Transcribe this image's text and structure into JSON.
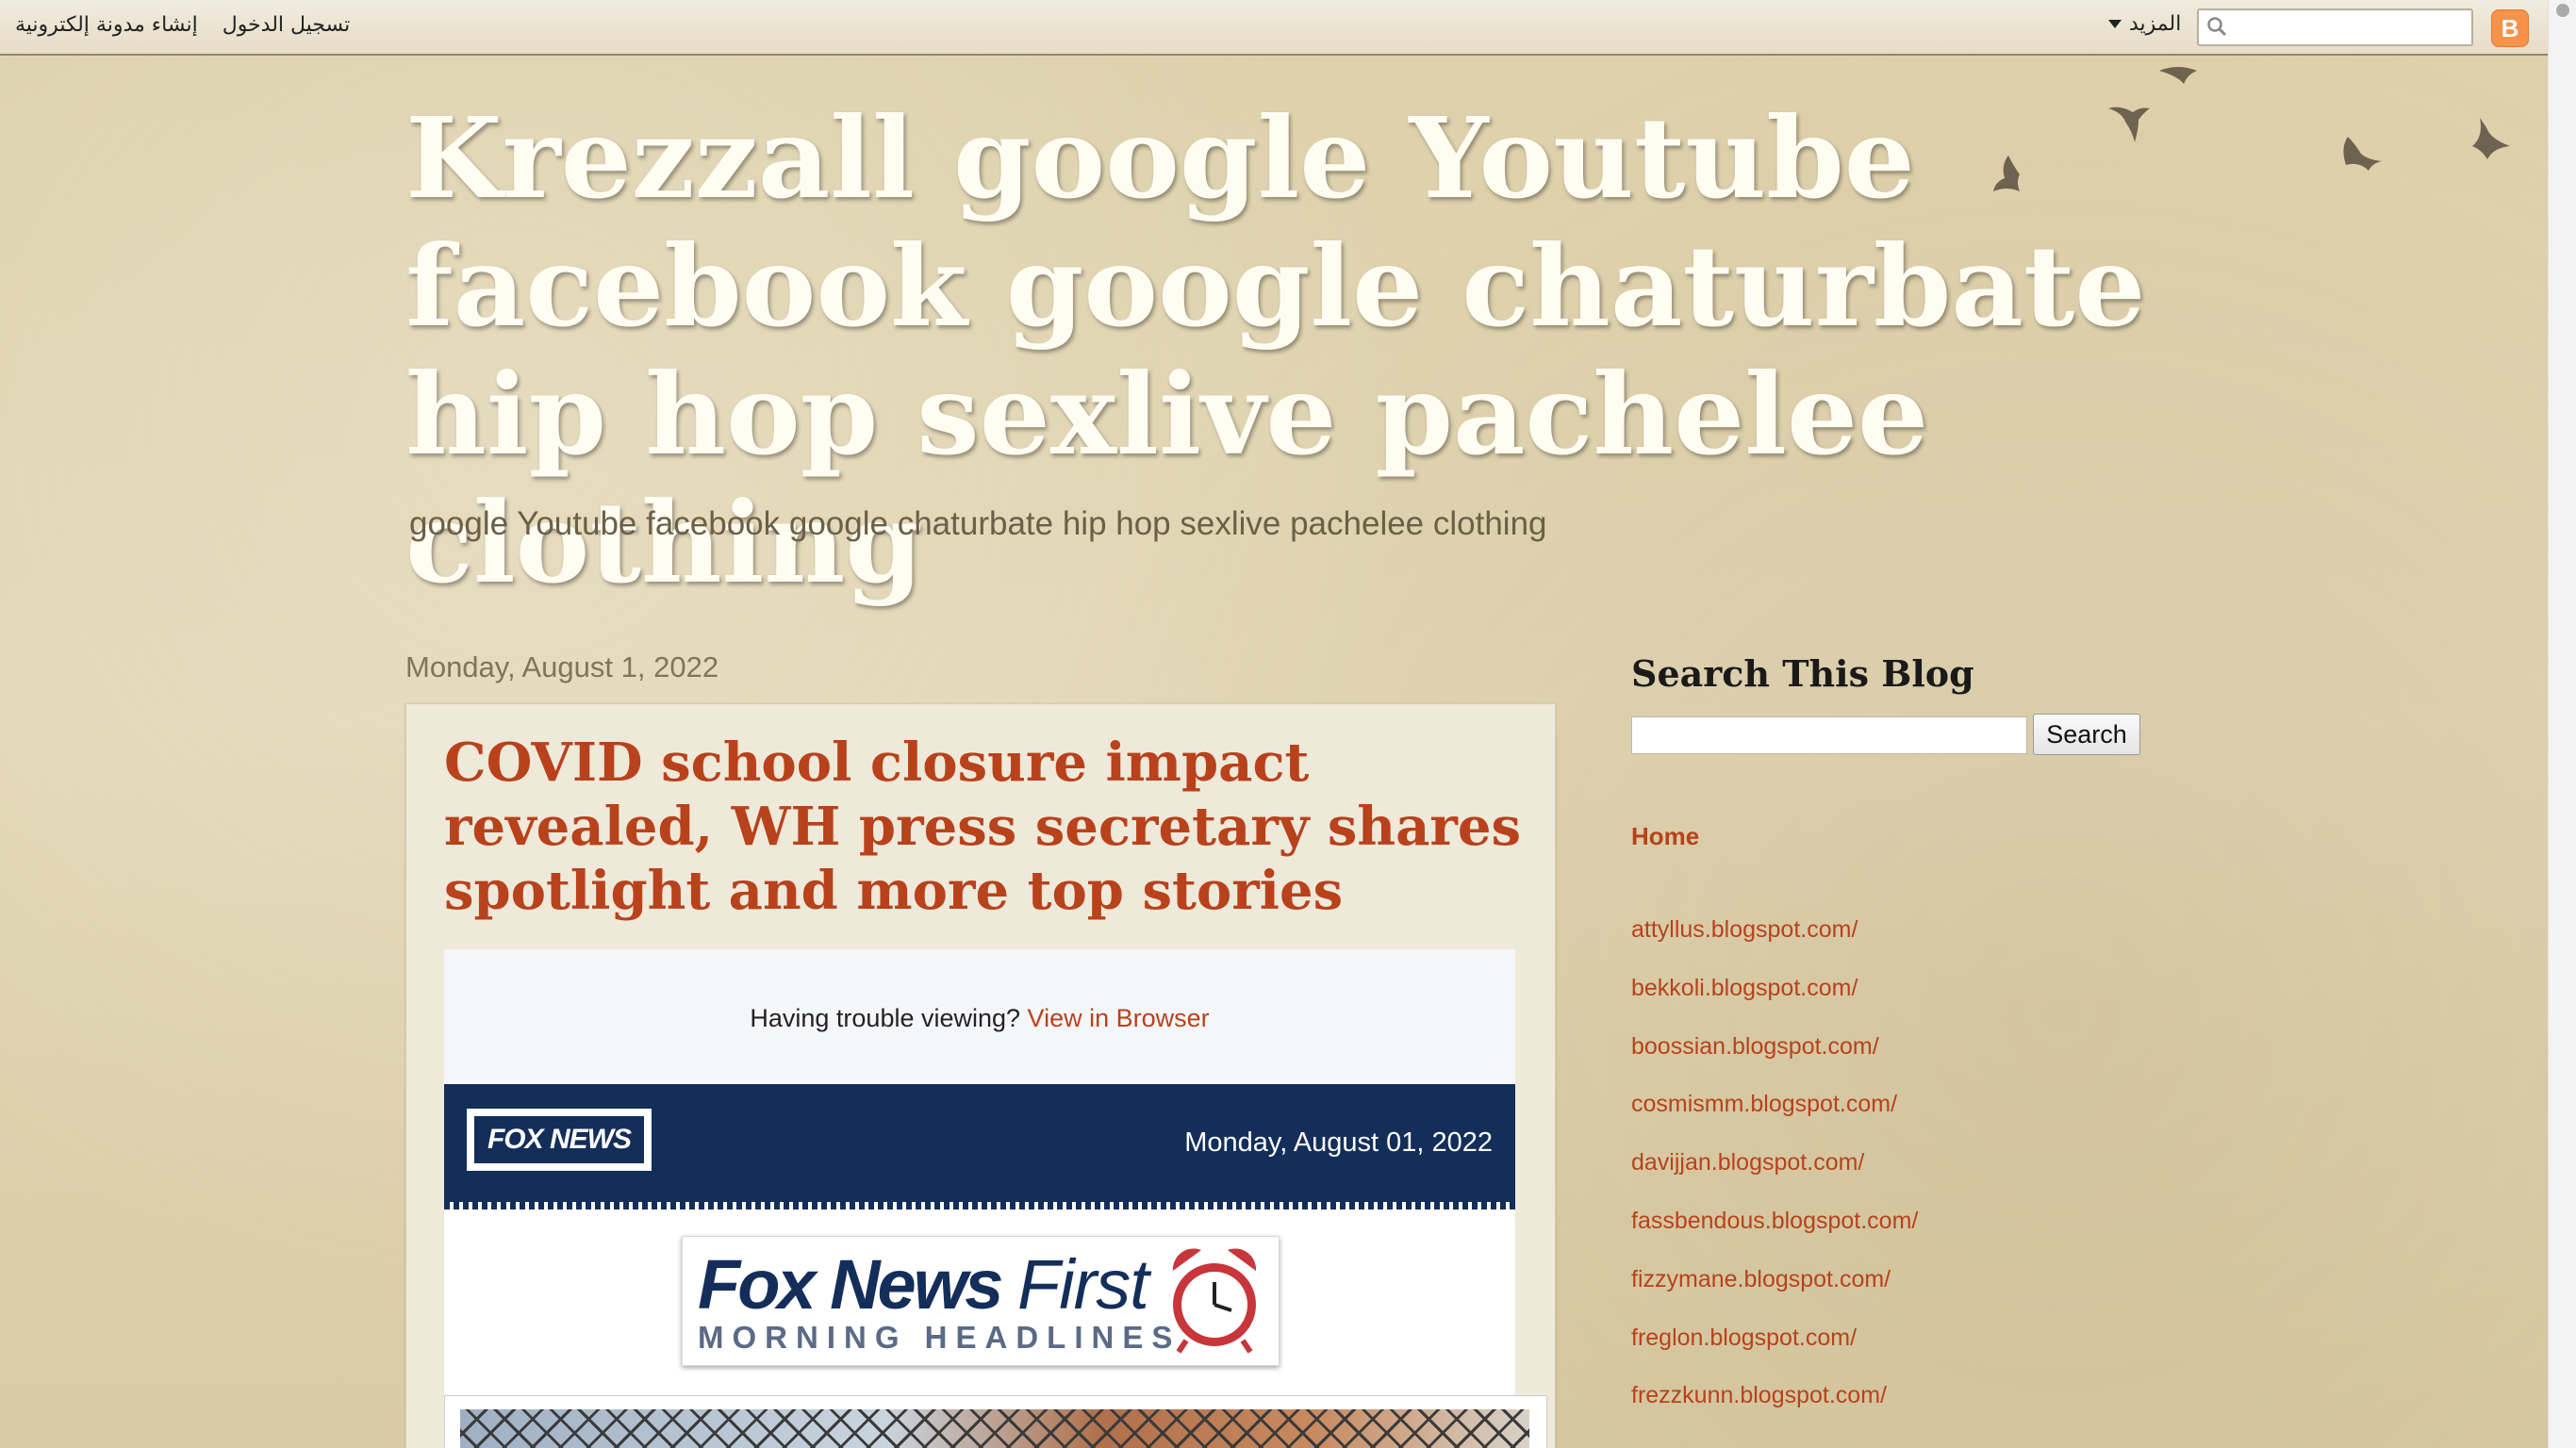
{
  "navbar": {
    "login_label": "تسجيل الدخول",
    "create_blog_label": "إنشاء مدونة إلكترونية",
    "more_label": "المزيد",
    "search_placeholder": "",
    "blogger_logo_letter": "B"
  },
  "header": {
    "title": "Krezzall google Youtube facebook google chaturbate hip hop sexlive pachelee clothing",
    "description": "google Youtube facebook google chaturbate hip hop sexlive pachelee clothing"
  },
  "post": {
    "date": "Monday, August 1, 2022",
    "title": "COVID school closure impact revealed, WH press secretary shares spotlight and more top stories",
    "trouble_text": "Having trouble viewing? ",
    "trouble_link": "View in Browser",
    "fox_logo_text": "FOX NEWS",
    "banner_date": "Monday, August 01, 2022",
    "fnf_main": "Fox News",
    "fnf_first": "First",
    "fnf_sub": "MORNING HEADLINES"
  },
  "sidebar": {
    "search_title": "Search This Blog",
    "search_button": "Search",
    "home_label": "Home",
    "links": [
      "attyllus.blogspot.com/",
      "bekkoli.blogspot.com/",
      "boossian.blogspot.com/",
      "cosmismm.blogspot.com/",
      "davijjan.blogspot.com/",
      "fassbendous.blogspot.com/",
      "fizzymane.blogspot.com/",
      "freglon.blogspot.com/",
      "frezzkunn.blogspot.com/"
    ]
  },
  "colors": {
    "accent": "#b8421b",
    "fox_navy": "#142e5a",
    "background": "#dfd2ae"
  }
}
